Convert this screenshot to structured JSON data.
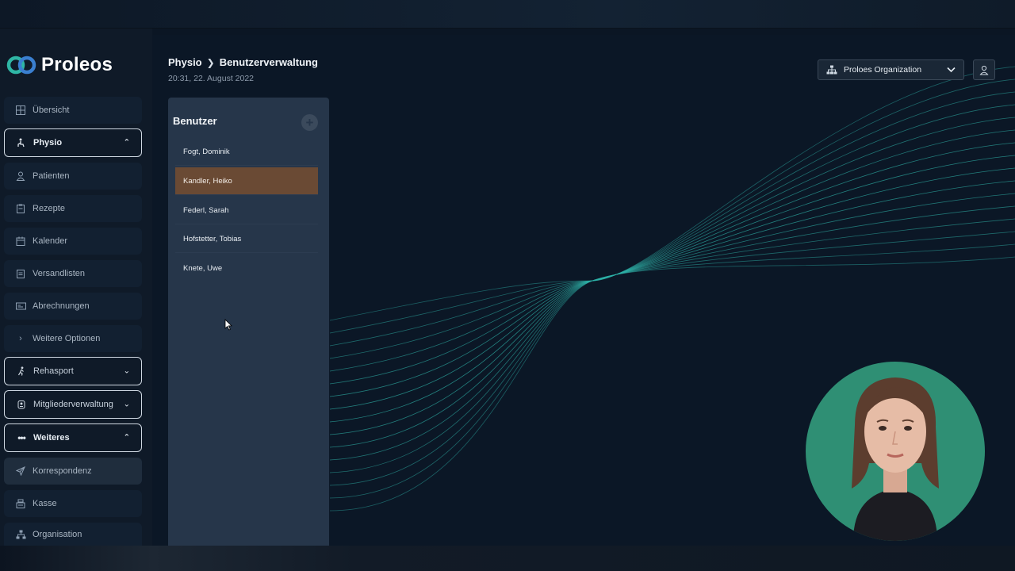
{
  "app": {
    "name": "Proleos"
  },
  "sidebar": {
    "items": [
      {
        "label": "Übersicht",
        "icon": "grid-icon"
      },
      {
        "label": "Physio",
        "icon": "physio-icon",
        "section": true,
        "expanded": true
      },
      {
        "label": "Patienten",
        "icon": "person-icon"
      },
      {
        "label": "Rezepte",
        "icon": "clipboard-icon"
      },
      {
        "label": "Kalender",
        "icon": "calendar-icon"
      },
      {
        "label": "Versandlisten",
        "icon": "list-clipboard-icon"
      },
      {
        "label": "Abrechnungen",
        "icon": "billing-icon"
      },
      {
        "label": "Weitere Optionen",
        "icon": "chevron-right-icon"
      },
      {
        "label": "Rehasport",
        "icon": "running-icon",
        "section": true,
        "expanded": false
      },
      {
        "label": "Mitgliederverwaltung",
        "icon": "members-icon",
        "section": true,
        "expanded": false
      },
      {
        "label": "Weiteres",
        "icon": "dots-icon",
        "section": true,
        "expanded": true
      },
      {
        "label": "Korrespondenz",
        "icon": "send-icon",
        "active": true
      },
      {
        "label": "Kasse",
        "icon": "register-icon"
      },
      {
        "label": "Organisation",
        "icon": "org-icon"
      }
    ]
  },
  "header": {
    "breadcrumb": [
      "Physio",
      "Benutzerverwaltung"
    ],
    "datetime": "20:31, 22. August 2022",
    "org_select": "Proloes Organization"
  },
  "users_panel": {
    "title": "Benutzer",
    "add_label": "+",
    "users": [
      {
        "name": "Fogt, Dominik",
        "selected": false
      },
      {
        "name": "Kandler, Heiko",
        "selected": true
      },
      {
        "name": "Federl, Sarah",
        "selected": false
      },
      {
        "name": "Hofstetter, Tobias",
        "selected": false
      },
      {
        "name": "Knete, Uwe",
        "selected": false
      }
    ]
  },
  "colors": {
    "background": "#0b1726",
    "sidebar": "#0f1a28",
    "panel": "#26364a",
    "selected_row": "#6a4a34",
    "lines": "#2fb2a8",
    "avatar_bg": "#2f8f74"
  }
}
